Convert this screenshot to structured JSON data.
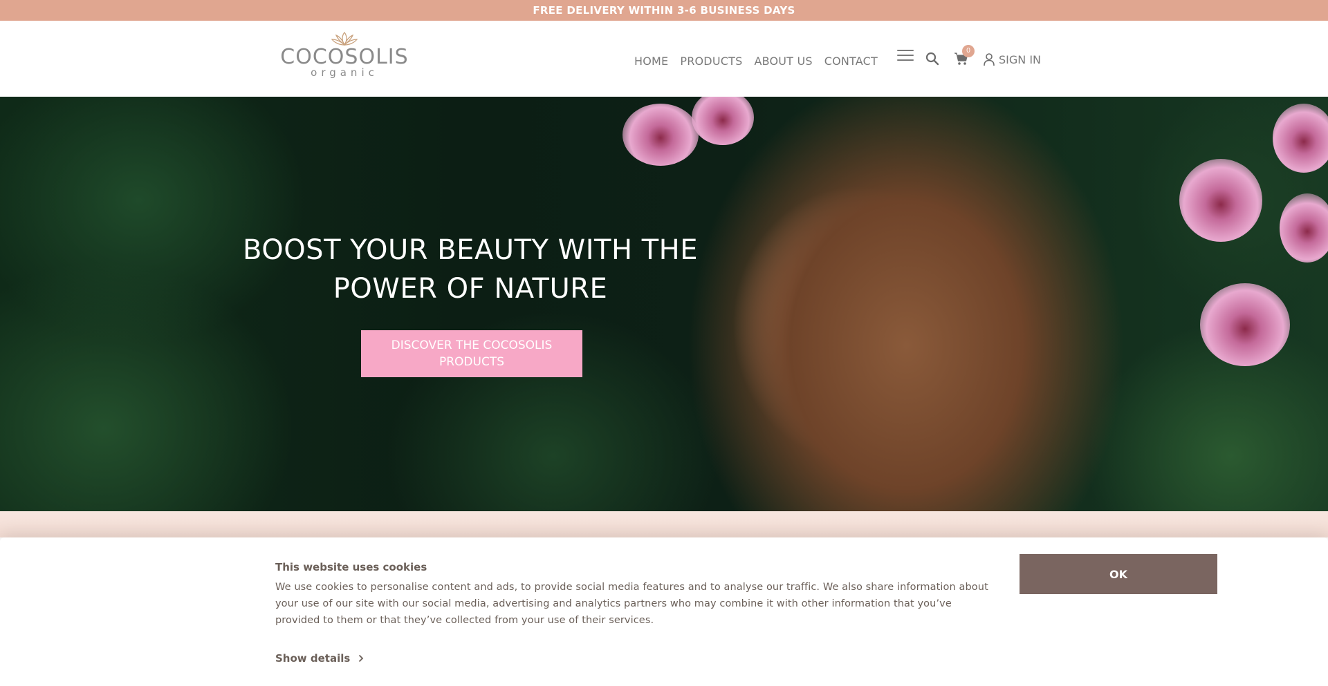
{
  "announcement": {
    "text": "FREE DELIVERY WITHIN 3-6 BUSINESS DAYS"
  },
  "header": {
    "logo": {
      "main": "COCOSOLIS",
      "sub": "organic",
      "icon": "lotus-icon"
    },
    "nav": [
      {
        "label": "HOME"
      },
      {
        "label": "PRODUCTS"
      },
      {
        "label": "ABOUT US"
      },
      {
        "label": "CONTACT"
      }
    ],
    "icons": {
      "menu": "hamburger-menu-icon",
      "search": "search-icon",
      "cart": "shopping-cart-icon",
      "user": "user-icon"
    },
    "cart_count": "0",
    "signin_label": "SIGN IN"
  },
  "hero": {
    "title_line1": "BOOST YOUR BEAUTY WITH THE",
    "title_line2": "POWER OF NATURE",
    "cta_label": "DISCOVER THE COCOSOLIS PRODUCTS"
  },
  "cookie_banner": {
    "title": "This website uses cookies",
    "text": "We use cookies to personalise content and ads, to provide social media features and to analyse our traffic. We also share information about your use of our site with our social media, advertising and analytics partners who may combine it with other information that you’ve provided to them or that they’ve collected from your use of their services.",
    "details_label": "Show details",
    "ok_label": "OK"
  },
  "colors": {
    "announcement_bg": "#e0a690",
    "cta_bg": "#f7a8c6",
    "ok_bg": "#7a6560",
    "nav_text": "#7a7a7a"
  }
}
